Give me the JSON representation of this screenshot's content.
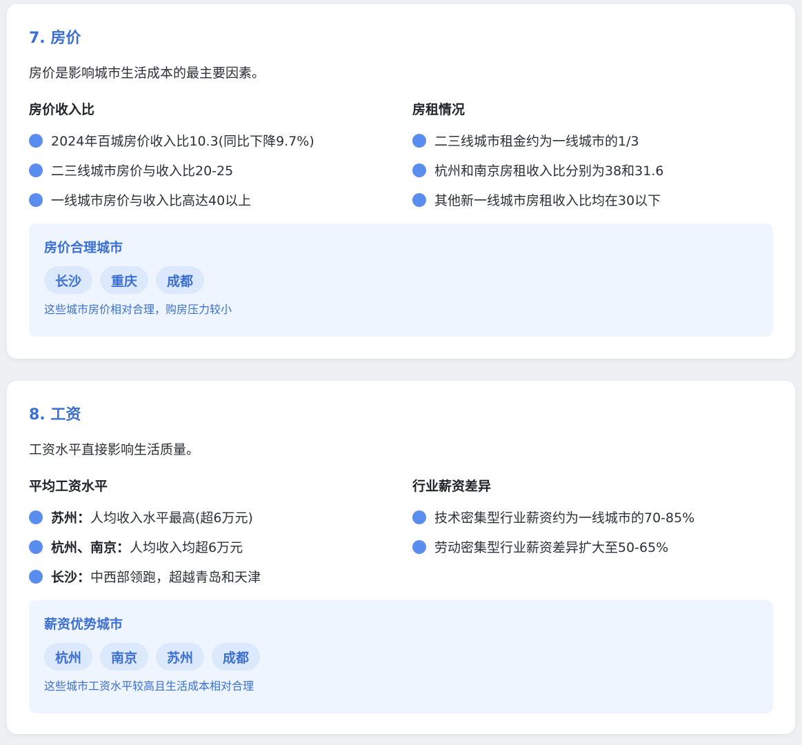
{
  "sections": [
    {
      "title": "7. 房价",
      "desc": "房价是影响城市生活成本的最主要因素。",
      "left": {
        "title": "房价收入比",
        "items": [
          {
            "strong": "",
            "text": "2024年百城房价收入比10.3(同比下降9.7%)"
          },
          {
            "strong": "",
            "text": "二三线城市房价与收入比20-25"
          },
          {
            "strong": "",
            "text": "一线城市房价与收入比高达40以上"
          }
        ]
      },
      "right": {
        "title": "房租情况",
        "items": [
          {
            "strong": "",
            "text": "二三线城市租金约为一线城市的1/3"
          },
          {
            "strong": "",
            "text": "杭州和南京房租收入比分别为38和31.6"
          },
          {
            "strong": "",
            "text": "其他新一线城市房租收入比均在30以下"
          }
        ]
      },
      "highlight": {
        "title": "房价合理城市",
        "tags": [
          "长沙",
          "重庆",
          "成都"
        ],
        "note": "这些城市房价相对合理，购房压力较小"
      }
    },
    {
      "title": "8. 工资",
      "desc": "工资水平直接影响生活质量。",
      "left": {
        "title": "平均工资水平",
        "items": [
          {
            "strong": "苏州：",
            "text": "人均收入水平最高(超6万元)"
          },
          {
            "strong": "杭州、南京：",
            "text": "人均收入均超6万元"
          },
          {
            "strong": "长沙：",
            "text": "中西部领跑，超越青岛和天津"
          }
        ]
      },
      "right": {
        "title": "行业薪资差异",
        "items": [
          {
            "strong": "",
            "text": "技术密集型行业薪资约为一线城市的70-85%"
          },
          {
            "strong": "",
            "text": "劳动密集型行业薪资差异扩大至50-65%"
          }
        ]
      },
      "highlight": {
        "title": "薪资优势城市",
        "tags": [
          "杭州",
          "南京",
          "苏州",
          "成都"
        ],
        "note": "这些城市工资水平较高且生活成本相对合理"
      }
    }
  ],
  "colors": {
    "accent": "#3b6fd4",
    "bullet": "#5b8def",
    "highlight_bg": "#eef5ff",
    "tag_bg": "#dce8fb"
  }
}
